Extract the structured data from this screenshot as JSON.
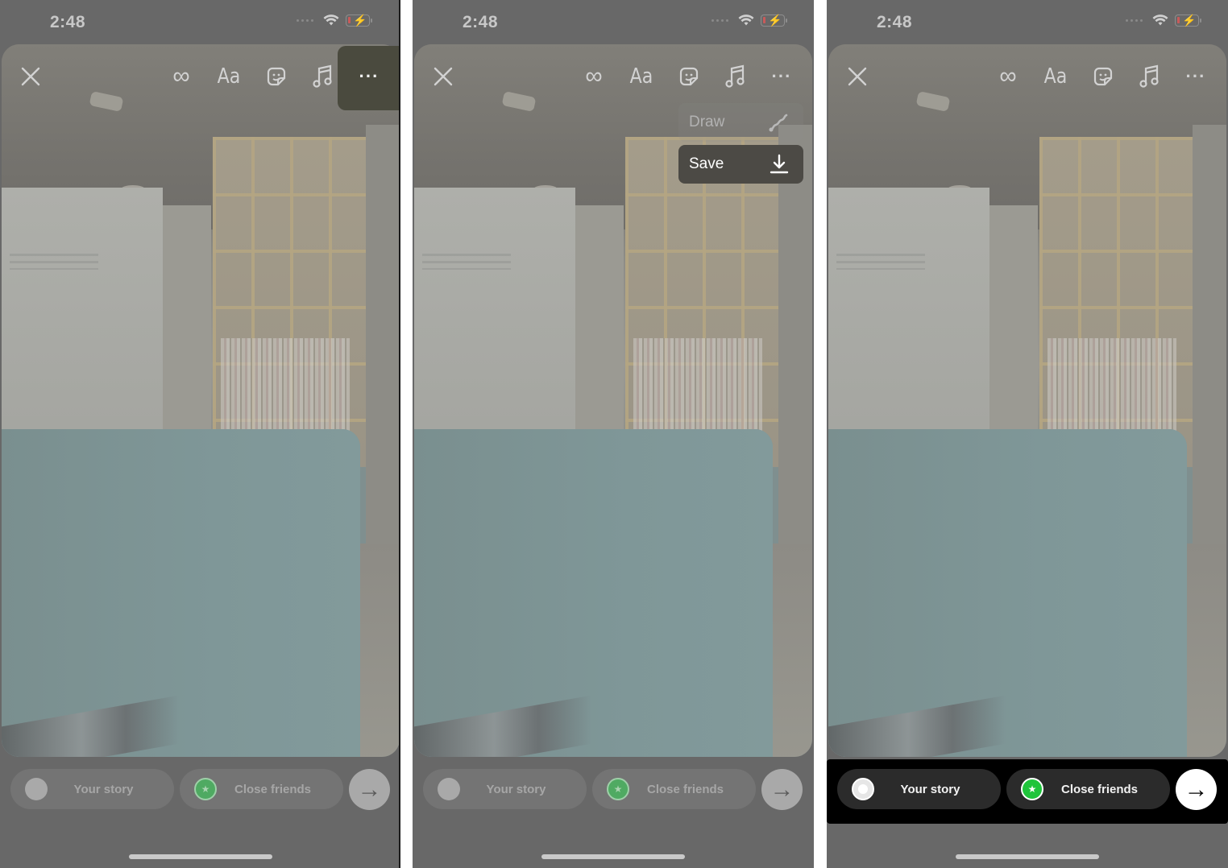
{
  "panels": [
    {
      "name": "step-1-more-options",
      "status_bar": {
        "time": "2:48"
      },
      "toolbar": {
        "close_icon": "close-icon",
        "boomerang_icon": "infinity-icon",
        "text_label": "Aa",
        "sticker_icon": "sticker-icon",
        "music_icon": "music-note-icon",
        "more_label": "···",
        "highlighted": "more"
      },
      "share_bar": {
        "your_story": "Your story",
        "close_friends": "Close friends",
        "next_icon": "→"
      }
    },
    {
      "name": "step-2-save-menu",
      "status_bar": {
        "time": "2:48"
      },
      "toolbar": {
        "text_label": "Aa",
        "more_label": "···"
      },
      "menu": {
        "items": [
          {
            "label": "Draw",
            "icon": "draw-squiggle-icon"
          },
          {
            "label": "Save",
            "icon": "download-icon",
            "highlighted": true
          }
        ]
      },
      "share_bar": {
        "your_story": "Your story",
        "close_friends": "Close friends",
        "next_icon": "→"
      }
    },
    {
      "name": "step-3-share",
      "status_bar": {
        "time": "2:48"
      },
      "toolbar": {
        "text_label": "Aa",
        "more_label": "···"
      },
      "share_bar": {
        "your_story": "Your story",
        "close_friends": "Close friends",
        "next_icon": "→",
        "highlighted": true
      }
    }
  ],
  "colors": {
    "close_friends_green": "#1fc43b",
    "overlay_gray": "#686868",
    "save_highlight": "#4c4a45"
  }
}
